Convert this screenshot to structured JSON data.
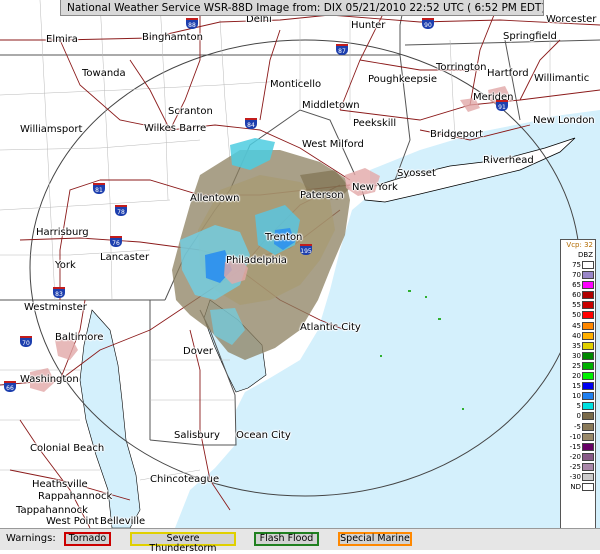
{
  "title": "National Weather Service WSR-88D Image  from: DIX 05/21/2010  22:52 UTC  ( 6:52 PM EDT)",
  "legend": {
    "mode_label": "Vcp: 32",
    "unit": "DBZ",
    "rows": [
      {
        "label": "75",
        "color": "#ffffff"
      },
      {
        "label": "70",
        "color": "#9a86c8"
      },
      {
        "label": "65",
        "color": "#ff00ff"
      },
      {
        "label": "60",
        "color": "#b00000"
      },
      {
        "label": "55",
        "color": "#c80000"
      },
      {
        "label": "50",
        "color": "#ff0000"
      },
      {
        "label": "45",
        "color": "#ff8800"
      },
      {
        "label": "40",
        "color": "#ffb000"
      },
      {
        "label": "35",
        "color": "#e0d000"
      },
      {
        "label": "30",
        "color": "#008800"
      },
      {
        "label": "25",
        "color": "#00b000"
      },
      {
        "label": "20",
        "color": "#00f000"
      },
      {
        "label": "15",
        "color": "#0000f0"
      },
      {
        "label": "10",
        "color": "#2080f0"
      },
      {
        "label": "5",
        "color": "#00e0e0"
      },
      {
        "label": "0",
        "color": "#7a6a4a"
      },
      {
        "label": "-5",
        "color": "#8a7a5a"
      },
      {
        "label": "-10",
        "color": "#9a8a6a"
      },
      {
        "label": "-15",
        "color": "#660066"
      },
      {
        "label": "-20",
        "color": "#885a88"
      },
      {
        "label": "-25",
        "color": "#aa88aa"
      },
      {
        "label": "-30",
        "color": "#cccccc"
      },
      {
        "label": "ND",
        "color": "#ffffff"
      }
    ]
  },
  "warnings": {
    "label": "Warnings:",
    "items": [
      {
        "label": "Tornado",
        "color": "#cc0000"
      },
      {
        "label": "Severe Thunderstorm",
        "color": "#e0d000"
      },
      {
        "label": "Flash Flood",
        "color": "#208020"
      },
      {
        "label": "Special Marine",
        "color": "#ff8800"
      }
    ]
  },
  "cities": {
    "elmira": "Elmira",
    "binghamton": "Binghamton",
    "delhi": "Delhi",
    "hunter": "Hunter",
    "worcester": "Worcester",
    "springfield": "Springfield",
    "towanda": "Towanda",
    "monticello": "Monticello",
    "poughkeepsie": "Poughkeepsie",
    "torrington": "Torrington",
    "hartford": "Hartford",
    "willimantic": "Willimantic",
    "middletown": "Middletown",
    "meriden": "Meriden",
    "new_london": "New London",
    "williamsport": "Williamsport",
    "scranton": "Scranton",
    "wilkes_barre": "Wilkes Barre",
    "peekskill": "Peekskill",
    "bridgeport": "Bridgeport",
    "west_milford": "West Milford",
    "riverhead": "Riverhead",
    "syosset": "Syosset",
    "new_york": "New York",
    "paterson": "Paterson",
    "allentown": "Allentown",
    "harrisburg": "Harrisburg",
    "trenton": "Trenton",
    "lancaster": "Lancaster",
    "philadelphia": "Philadelphia",
    "york": "York",
    "westminster": "Westminster",
    "atlantic_city": "Atlantic City",
    "baltimore": "Baltimore",
    "dover": "Dover",
    "washington": "Washington",
    "salisbury": "Salisbury",
    "ocean_city": "Ocean City",
    "colonial_beach": "Colonial Beach",
    "chincoteague": "Chincoteague",
    "heathsville": "Heathsville",
    "rappahannock": "Rappahannock",
    "west_point": "West Point",
    "tappahannock": "Tappahannock",
    "belleville": "Belleville"
  },
  "shields": {
    "i88": "88",
    "i84": "84",
    "i87": "87",
    "i90": "90",
    "i91": "91",
    "i81": "81",
    "i78": "78",
    "i76": "76",
    "i195": "195",
    "i83": "83",
    "i70": "70",
    "i66": "66"
  }
}
